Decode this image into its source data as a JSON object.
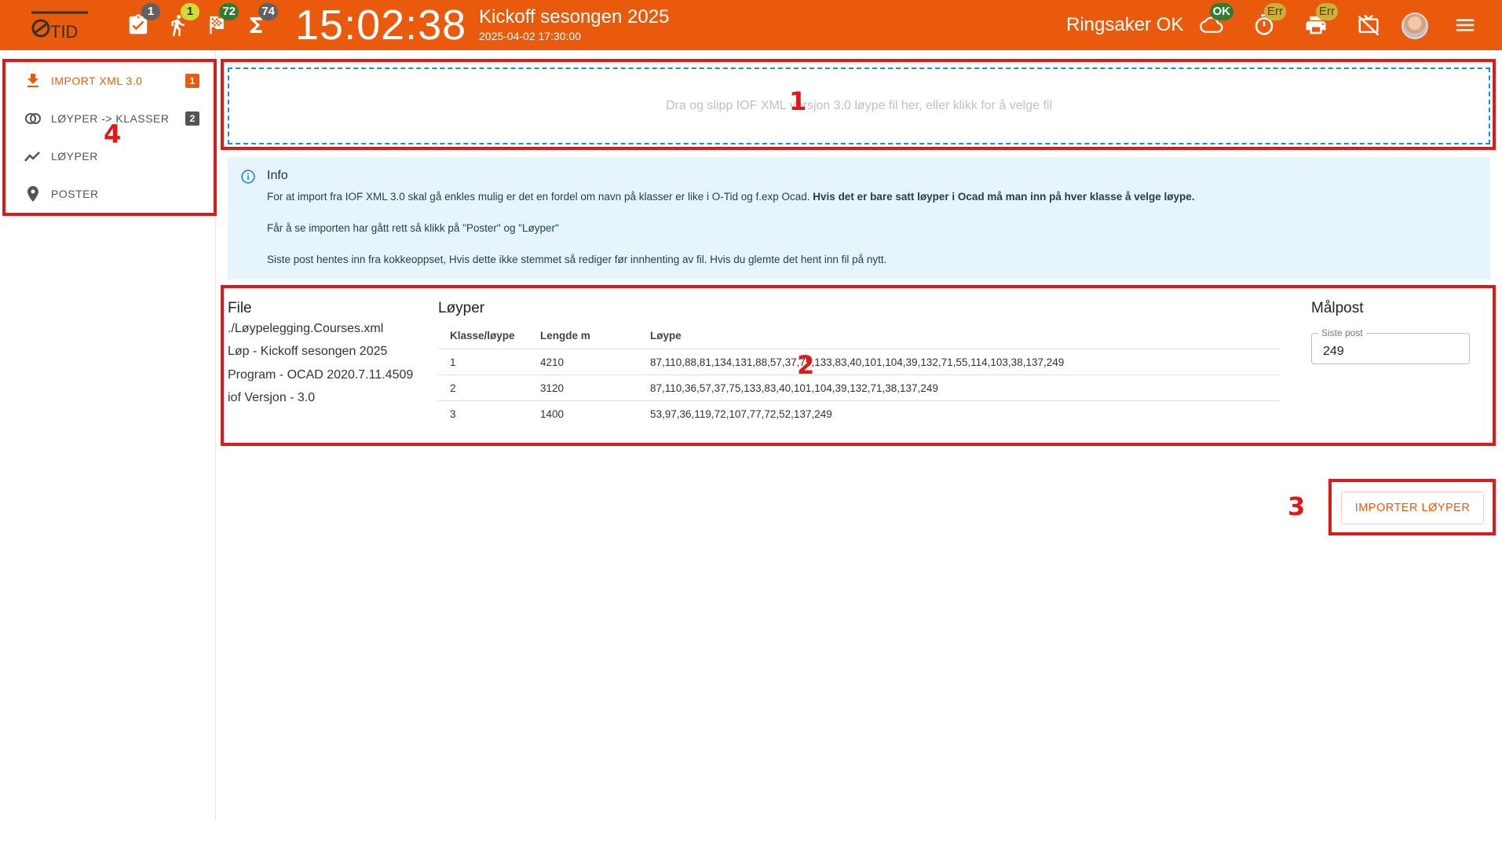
{
  "header": {
    "logo_text": "OTID",
    "clock": "15:02:38",
    "event_title": "Kickoff sesongen 2025",
    "event_date": "2025-04-02 17:30:00",
    "club": "Ringsaker OK",
    "badges": {
      "tasks": "1",
      "runners": "1",
      "finished": "72",
      "total": "74",
      "cloud": "OK",
      "timer": "Err",
      "printer": "Err"
    }
  },
  "sidebar": {
    "items": [
      {
        "label": "IMPORT XML 3.0",
        "count": "1",
        "icon": "download-icon"
      },
      {
        "label": "LØYPER -> KLASSER",
        "count": "2",
        "icon": "toggle-circles-icon"
      },
      {
        "label": "LØYPER",
        "icon": "trend-line-icon"
      },
      {
        "label": "POSTER",
        "icon": "map-pin-icon"
      }
    ]
  },
  "dropzone": {
    "text": "Dra og slipp IOF XML versjon 3.0 løype fil her, eller klikk for å velge fil"
  },
  "info": {
    "title": "Info",
    "line1_normal": "For at import fra IOF XML 3.0 skal gå enkles mulig er det en fordel om navn på klasser er like i O-Tid og f.exp Ocad. ",
    "line1_bold": "Hvis det er bare satt løyper i Ocad må man inn på hver klasse å velge løype.",
    "line2": "Får å se importen har gått rett så klikk på \"Poster\" og \"Løyper\"",
    "line3": "Siste post hentes inn fra kokkeoppset, Hvis dette ikke stemmet så rediger før innhenting av fil. Hvis du glemte det hent inn fil på nytt."
  },
  "file": {
    "title": "File",
    "lines": [
      "./Løypelegging.Courses.xml",
      "Løp - Kickoff sesongen 2025",
      "Program - OCAD 2020.7.11.4509",
      "iof Versjon - 3.0"
    ]
  },
  "courses": {
    "title": "Løyper",
    "headers": [
      "Klasse/løype",
      "Lengde m",
      "Løype"
    ],
    "rows": [
      [
        "1",
        "4210",
        "87,110,88,81,134,131,88,57,37,75,133,83,40,101,104,39,132,71,55,114,103,38,137,249"
      ],
      [
        "2",
        "3120",
        "87,110,36,57,37,75,133,83,40,101,104,39,132,71,38,137,249"
      ],
      [
        "3",
        "1400",
        "53,97,36,119,72,107,77,72,52,137,249"
      ]
    ]
  },
  "malpost": {
    "title": "Målpost",
    "field_label": "Siste post",
    "value": "249"
  },
  "import_button": "IMPORTER LØYPER",
  "annotations": [
    "1",
    "2",
    "3",
    "4"
  ],
  "colors": {
    "primary": "#ea5a0c",
    "annotation": "#e01818",
    "info_bg": "#e6f5fb",
    "dropzone_border": "#1e88e5"
  }
}
